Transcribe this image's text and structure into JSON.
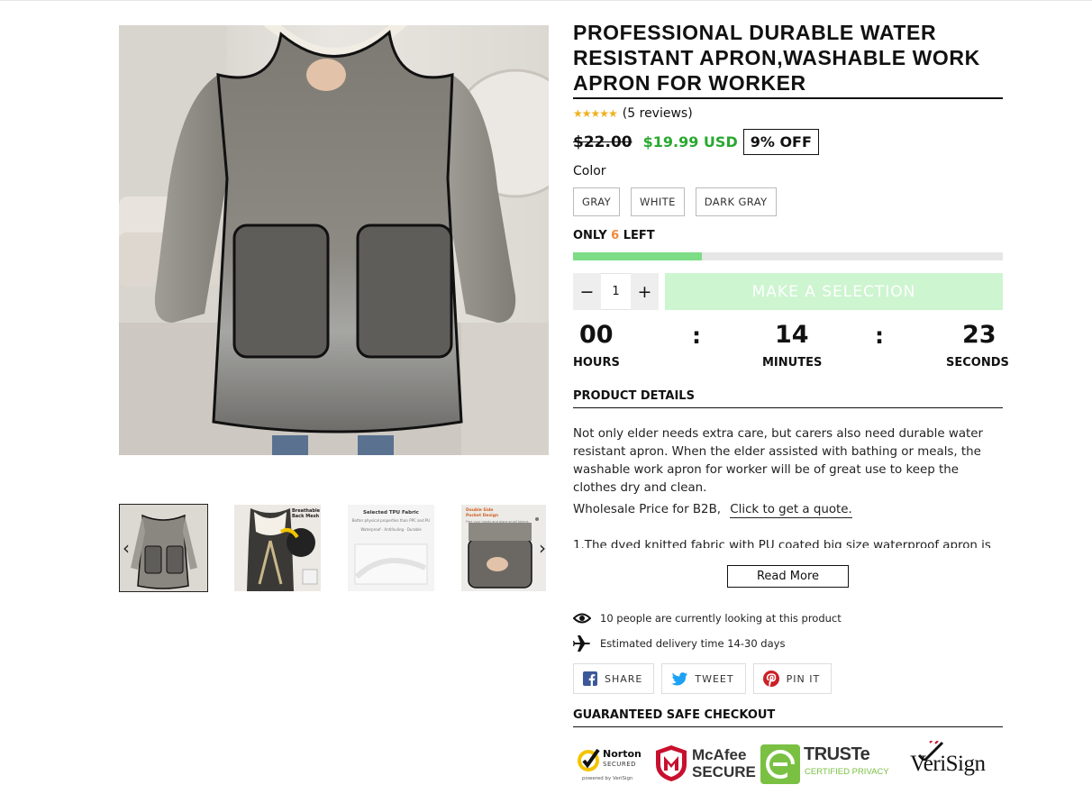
{
  "product": {
    "title": "PROFESSIONAL DURABLE WATER RESISTANT APRON,WASHABLE WORK APRON FOR WORKER",
    "stars": "★★★★★",
    "reviews": "(5 reviews)",
    "old_price": "$22.00",
    "new_price": "$19.99 USD",
    "discount": "9% OFF",
    "color_label": "Color",
    "colors": [
      "GRAY",
      "WHITE",
      "DARK GRAY"
    ],
    "stock_prefix": "ONLY",
    "stock_count": "6",
    "stock_suffix": "LEFT",
    "stock_level_percent": 30,
    "quantity": "1",
    "qty_minus": "−",
    "qty_plus": "+",
    "cta_label": "MAKE A SELECTION"
  },
  "countdown": {
    "hours": "00",
    "minutes": "14",
    "seconds": "23",
    "hours_label": "HOURS",
    "minutes_label": "MINUTES",
    "seconds_label": "SECONDS",
    "separator": ":"
  },
  "details": {
    "section_title": "PRODUCT DETAILS",
    "description": "Not only elder needs extra care, but carers also need durable water resistant apron. When the elder assisted with bathing or meals, the washable work apron for worker will be of great use to keep the clothes dry and clean.",
    "wholesale_text": "Wholesale Price for B2B,",
    "wholesale_link": "Click to get a quote.",
    "cut_text": "1.The dyed knitted fabric with PU coated big size waterproof apron is",
    "read_more": "Read More"
  },
  "social_proof": {
    "viewers": "10 people are currently looking at this product",
    "delivery": "Estimated delivery time 14-30 days"
  },
  "share": {
    "facebook": "SHARE",
    "twitter": "TWEET",
    "pinterest": "PIN IT"
  },
  "checkout": {
    "title": "GUARANTEED SAFE CHECKOUT",
    "norton_1": "Norton",
    "norton_2": "SECURED",
    "norton_3": "powered by VeriSign",
    "mcafee_1": "McAfee",
    "mcafee_2": "SECURE",
    "truste_1": "TRUSTe",
    "truste_2": "CERTIFIED PRIVACY",
    "verisign": "VeriSign"
  },
  "gallery": {
    "thumb3_title": "Selected TPU Fabric",
    "thumb3_sub": "Better physical properties than PPC and PU",
    "thumb3_tags": "Waterproof · Antifouling · Durable",
    "thumb2_title": "Breathable Back Mesh",
    "thumb4_title": "Double Side Pocket Design",
    "thumb4_sub": "Free your hands and place small tokens"
  },
  "colors": {
    "price_green": "#2aa830",
    "stock_orange": "#f08a3c",
    "bar_green": "#7ddc86",
    "cta_bg": "#cdf5d0",
    "star": "#f0b020",
    "facebook": "#3b5998",
    "twitter": "#1da1f2",
    "pinterest": "#cb2027"
  }
}
